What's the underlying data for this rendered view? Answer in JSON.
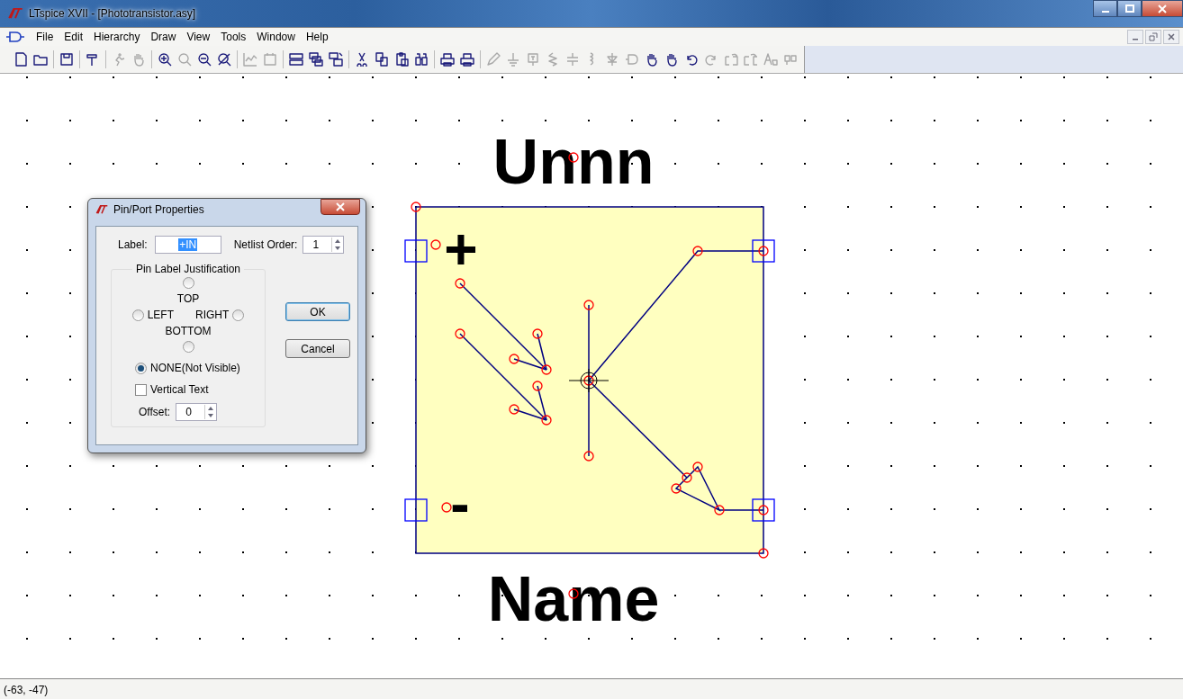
{
  "window": {
    "title": "LTspice XVII - [Phototransistor.asy]"
  },
  "menu": [
    "File",
    "Edit",
    "Hierarchy",
    "Draw",
    "View",
    "Tools",
    "Window",
    "Help"
  ],
  "symbol": {
    "prefix_text": "Unnn",
    "name_text": "Name",
    "plus_text": "+",
    "minus_text": "-"
  },
  "dialog": {
    "title": "Pin/Port Properties",
    "label_caption": "Label:",
    "label_value": "+IN",
    "netlist_caption": "Netlist Order:",
    "netlist_value": "1",
    "group_title": "Pin Label Justification",
    "radios": [
      {
        "label": "TOP",
        "selected": false
      },
      {
        "label": "LEFT",
        "selected": false
      },
      {
        "label": "RIGHT",
        "selected": false
      },
      {
        "label": "BOTTOM",
        "selected": false
      },
      {
        "label": "NONE(Not Visible)",
        "selected": true
      }
    ],
    "vertical_text": {
      "label": "Vertical Text",
      "checked": false
    },
    "offset_caption": "Offset:",
    "offset_value": "0",
    "buttons": [
      "OK",
      "Cancel"
    ]
  },
  "status_bar": "(-63, -47)"
}
